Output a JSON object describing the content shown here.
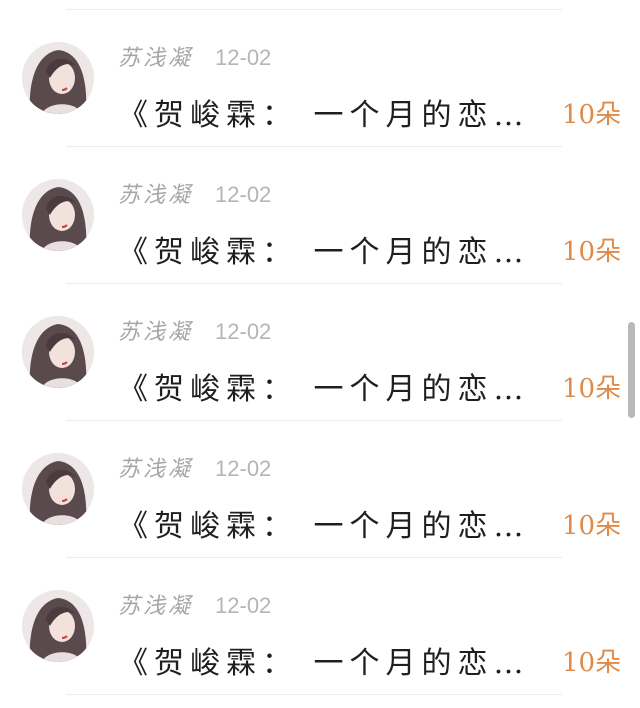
{
  "rows": [
    {
      "name": "苏浅凝",
      "date": "12-02",
      "title": "《贺峻霖： 一个月的恋…",
      "count": "10朵"
    },
    {
      "name": "苏浅凝",
      "date": "12-02",
      "title": "《贺峻霖： 一个月的恋…",
      "count": "10朵"
    },
    {
      "name": "苏浅凝",
      "date": "12-02",
      "title": "《贺峻霖： 一个月的恋…",
      "count": "10朵"
    },
    {
      "name": "苏浅凝",
      "date": "12-02",
      "title": "《贺峻霖： 一个月的恋…",
      "count": "10朵"
    },
    {
      "name": "苏浅凝",
      "date": "12-02",
      "title": "《贺峻霖： 一个月的恋…",
      "count": "10朵"
    }
  ],
  "colors": {
    "count": "#e08a4a",
    "name": "#a6a6a6",
    "date": "#b5b5b5",
    "title": "#1f1f1f"
  }
}
